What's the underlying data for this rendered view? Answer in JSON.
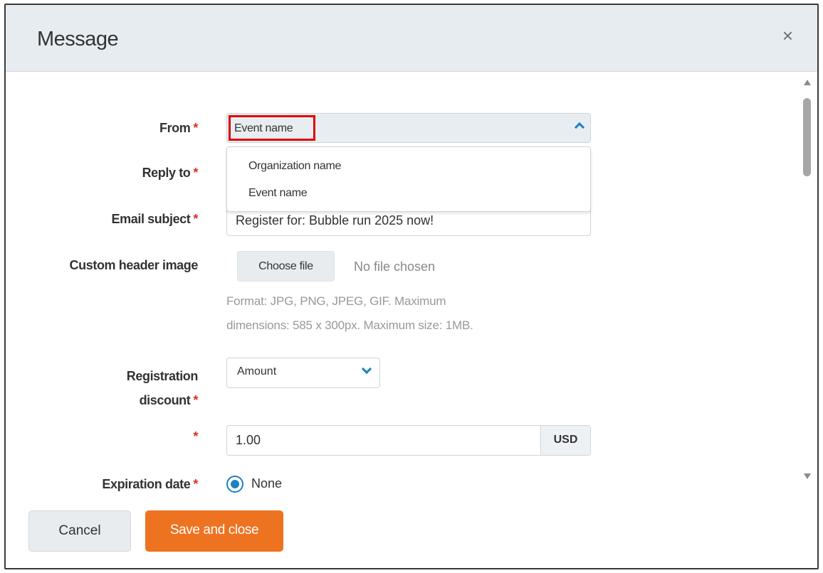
{
  "modal": {
    "title": "Message",
    "close_symbol": "×"
  },
  "form": {
    "from": {
      "label": "From",
      "required": "*",
      "selected": "Event name",
      "options": [
        "Organization name",
        "Event name"
      ]
    },
    "reply_to": {
      "label": "Reply to",
      "required": "*",
      "value": ""
    },
    "email_subject": {
      "label": "Email subject",
      "required": "*",
      "value": "Register for: Bubble run 2025 now!"
    },
    "custom_header_image": {
      "label": "Custom header image",
      "button_label": "Choose file",
      "status": "No file chosen",
      "help_line1": "Format: JPG, PNG, JPEG, GIF. Maximum",
      "help_line2": "dimensions: 585 x 300px. Maximum size: 1MB."
    },
    "registration_discount": {
      "label_line1": "Registration",
      "label_line2": "discount",
      "required": "*",
      "selected": "Amount"
    },
    "discount_value": {
      "required": "*",
      "value": "1.00",
      "currency": "USD"
    },
    "expiration_date": {
      "label": "Expiration date",
      "required": "*",
      "selected_option": "None"
    }
  },
  "footer": {
    "cancel_label": "Cancel",
    "save_label": "Save and close"
  },
  "colors": {
    "accent": "#ee7320",
    "header_bg": "#e7ecf0",
    "required": "#d8332a",
    "highlight_box": "#e00000",
    "link_blue": "#1f7fc1"
  },
  "icons": {
    "close": "close-icon",
    "from_chevron": "chevron-up-icon",
    "discount_chevron": "chevron-down-icon",
    "scroll_up": "scroll-up-arrow-icon",
    "scroll_down": "scroll-down-arrow-icon"
  }
}
